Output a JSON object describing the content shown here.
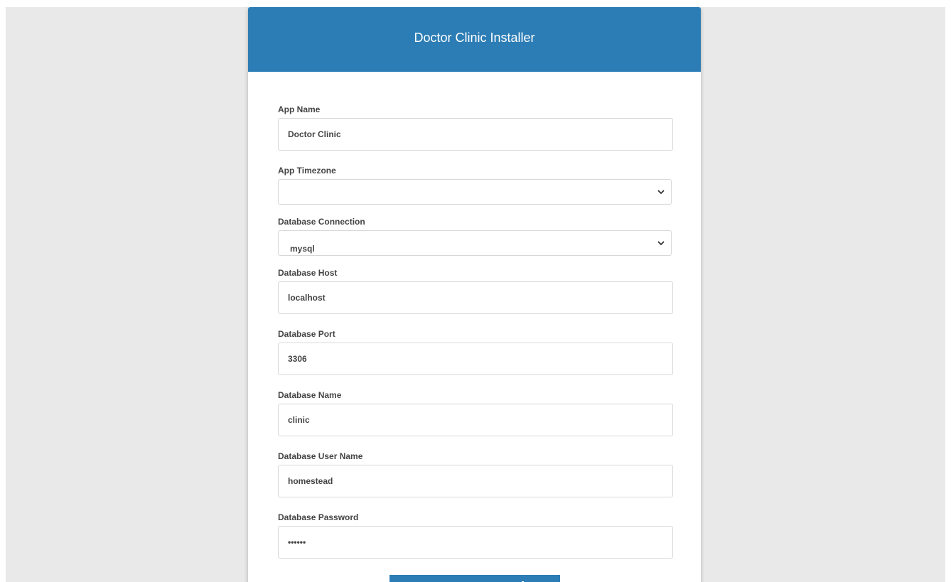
{
  "header": {
    "title": "Doctor Clinic Installer"
  },
  "form": {
    "app_name": {
      "label": "App Name",
      "value": "Doctor Clinic"
    },
    "app_timezone": {
      "label": "App Timezone",
      "value": ""
    },
    "db_connection": {
      "label": "Database Connection",
      "value": "mysql"
    },
    "db_host": {
      "label": "Database Host",
      "value": "localhost"
    },
    "db_port": {
      "label": "Database Port",
      "value": "3306"
    },
    "db_name": {
      "label": "Database Name",
      "value": "clinic"
    },
    "db_user": {
      "label": "Database User Name",
      "value": "homestead"
    },
    "db_password": {
      "label": "Database Password",
      "value": "••••••"
    },
    "test_button_label": "Test DB Connection"
  },
  "colors": {
    "primary": "#2c7db5",
    "page_bg": "#e9e9e9"
  },
  "icons": {
    "select_arrow": "chevron-down-icon"
  }
}
